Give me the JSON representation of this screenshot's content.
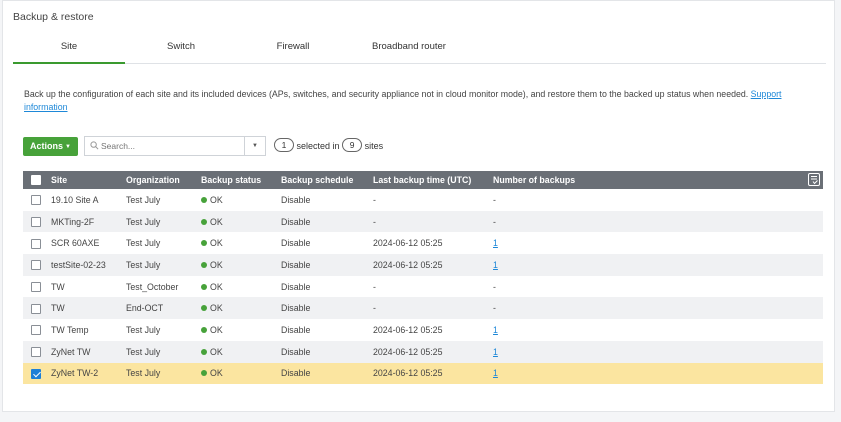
{
  "panel": {
    "title": "Backup & restore"
  },
  "tabs": [
    {
      "label": "Site",
      "active": true
    },
    {
      "label": "Switch",
      "active": false
    },
    {
      "label": "Firewall",
      "active": false
    },
    {
      "label": "Broadband router",
      "active": false
    }
  ],
  "description": {
    "text": "Back up the configuration of each site and its included devices (APs, switches, and security appliance not in cloud monitor mode), and restore them to the backed up status when needed.",
    "link_label": "Support information"
  },
  "toolbar": {
    "actions_label": "Actions",
    "search_placeholder": "Search...",
    "selected_count": "1",
    "selected_in_text": "selected in",
    "total_count": "9",
    "sites_text": "sites"
  },
  "table": {
    "columns": [
      "Site",
      "Organization",
      "Backup status",
      "Backup schedule",
      "Last backup time (UTC)",
      "Number of backups"
    ],
    "rows": [
      {
        "site": "19.10 Site A",
        "org": "Test July",
        "status": "OK",
        "schedule": "Disable",
        "last": "-",
        "count": "-",
        "checked": false
      },
      {
        "site": "MKTing-2F",
        "org": "Test July",
        "status": "OK",
        "schedule": "Disable",
        "last": "-",
        "count": "-",
        "checked": false
      },
      {
        "site": "SCR 60AXE",
        "org": "Test July",
        "status": "OK",
        "schedule": "Disable",
        "last": "2024-06-12 05:25",
        "count": "1",
        "checked": false
      },
      {
        "site": "testSite-02-23",
        "org": "Test July",
        "status": "OK",
        "schedule": "Disable",
        "last": "2024-06-12 05:25",
        "count": "1",
        "checked": false
      },
      {
        "site": "TW",
        "org": "Test_October",
        "status": "OK",
        "schedule": "Disable",
        "last": "-",
        "count": "-",
        "checked": false
      },
      {
        "site": "TW",
        "org": "End-OCT",
        "status": "OK",
        "schedule": "Disable",
        "last": "-",
        "count": "-",
        "checked": false
      },
      {
        "site": "TW Temp",
        "org": "Test July",
        "status": "OK",
        "schedule": "Disable",
        "last": "2024-06-12 05:25",
        "count": "1",
        "checked": false
      },
      {
        "site": "ZyNet TW",
        "org": "Test July",
        "status": "OK",
        "schedule": "Disable",
        "last": "2024-06-12 05:25",
        "count": "1",
        "checked": false
      },
      {
        "site": "ZyNet TW-2",
        "org": "Test July",
        "status": "OK",
        "schedule": "Disable",
        "last": "2024-06-12 05:25",
        "count": "1",
        "checked": true
      }
    ]
  },
  "colors": {
    "accent": "#47a23a",
    "link": "#1e88d8",
    "header_bg": "#6a6f76",
    "selected_row": "#fbe5a0"
  }
}
